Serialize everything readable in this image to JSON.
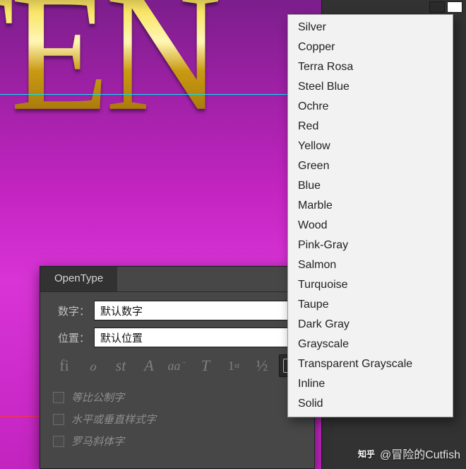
{
  "canvas": {
    "big_text": "TEN"
  },
  "dropdown": {
    "items": [
      "Silver",
      "Copper",
      "Terra Rosa",
      "Steel Blue",
      "Ochre",
      "Red",
      "Yellow",
      "Green",
      "Blue",
      "Marble",
      "Wood",
      "Pink-Gray",
      "Salmon",
      "Turquoise",
      "Taupe",
      "Dark Gray",
      "Grayscale",
      "Transparent Grayscale",
      "Inline",
      "Solid"
    ]
  },
  "opentype": {
    "tab_label": "OpenType",
    "figure_label": "数字：",
    "figure_value": "默认数字",
    "position_label": "位置：",
    "position_value": "默认位置",
    "icons": {
      "ligature": "fi",
      "swash": "ℴ",
      "stylistic": "st",
      "contextual": "A",
      "smallcaps": "aa",
      "titling": "T",
      "ordinals_html": "1<sup>st</sup>",
      "fractions": "½",
      "a_box": "a"
    },
    "checks": [
      "等比公制字",
      "水平或垂直样式字",
      "罗马斜体字"
    ]
  },
  "watermark": {
    "logo": "知乎",
    "text": "@冒险的Cutfish"
  }
}
